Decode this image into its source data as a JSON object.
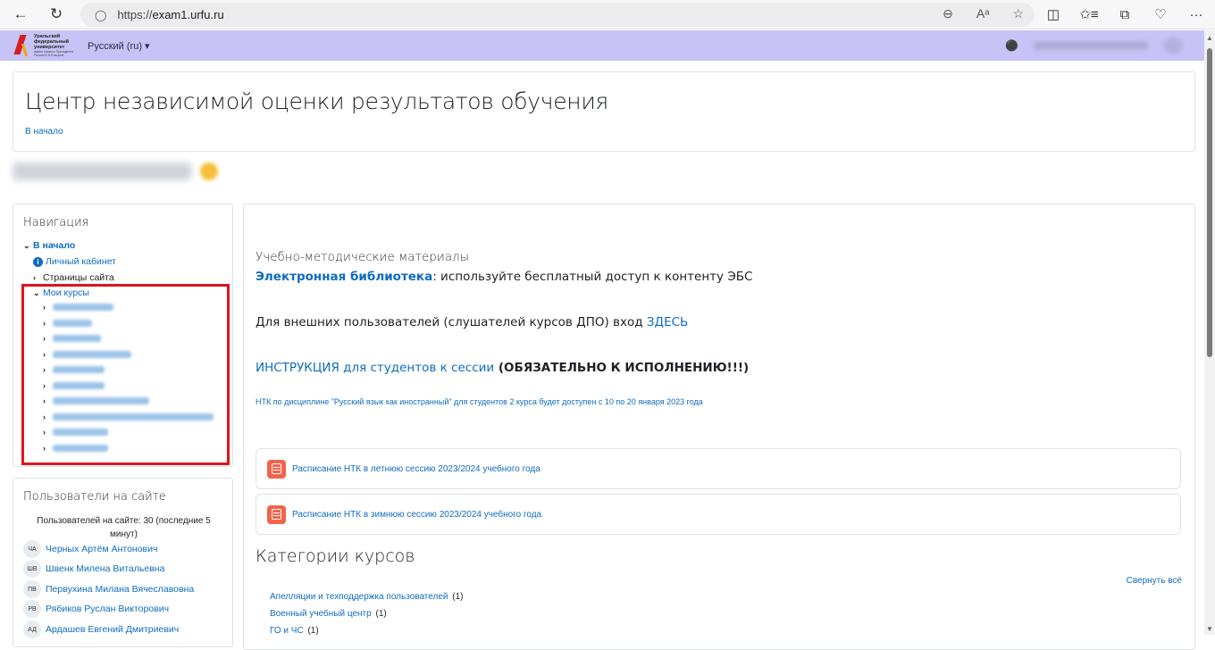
{
  "browser": {
    "url_protocol": "https://",
    "url_host": "exam1.urfu.ru",
    "icons": [
      "back-icon",
      "reload-icon",
      "lock-icon",
      "zoom-icon",
      "read-aloud-icon",
      "favorite-star-icon",
      "split-screen-icon",
      "favorites-icon",
      "collections-icon",
      "heart-pulse-icon",
      "more-icon"
    ],
    "back": "←",
    "reload": "↻",
    "lock": "🔒",
    "zoom": "⊖",
    "read_aloud": "Aᵃ",
    "star": "☆",
    "split": "◫",
    "favorites": "✩≡",
    "collections": "⧉",
    "health": "♡",
    "more": "···"
  },
  "header": {
    "logo_lines": "Уральский федеральный университет",
    "logo_small": "имени первого Президента России Б.Н.Ельцина",
    "language": "Русский (ru) ▾",
    "bell": "🔔",
    "accent_color": "#c7c3f6"
  },
  "page": {
    "title": "Центр независимой оценки результатов обучения",
    "breadcrumb": "В начало"
  },
  "navigation": {
    "title": "Навигация",
    "home": "В начало",
    "dashboard": "Личный кабинет",
    "site_pages": "Страницы сайта",
    "my_courses": "Мои курсы"
  },
  "users_online": {
    "title": "Пользователи на сайте",
    "count_text": "Пользователей на сайте: 30 (последние 5 минут)",
    "users": [
      {
        "initials": "ЧА",
        "name": "Черных Артём Антонович"
      },
      {
        "initials": "ШВ",
        "name": "Швенк Милена Витальевна"
      },
      {
        "initials": "ПВ",
        "name": "Первухина Милана Вячеславовна"
      },
      {
        "initials": "РВ",
        "name": "Рябиков Руслан Викторович"
      },
      {
        "initials": "АД",
        "name": "Ардашев Евгений Дмитриевич"
      }
    ]
  },
  "main": {
    "materials_label": "Учебно-методические материалы",
    "library_link": "Электронная библиотека",
    "library_text": ": используйте бесплатный доступ к контенту ЭБС",
    "external_text": "Для внешних пользователей (слушателей курсов ДПО) вход ",
    "external_link": "ЗДЕСЬ",
    "instruction_link": "ИНСТРУКЦИЯ для студентов к сессии",
    "instruction_bold": " (ОБЯЗАТЕЛЬНО К ИСПОЛНЕНИЮ!!!)",
    "ntk_notice": "НТК по дисциплине \"Русский язык как иностранный\" для студентов 2 курса будет доступен с 10 по 20 января 2023 года",
    "resources": [
      "Расписание НТК в летнюю сессию 2023/2024 учебного года",
      "Расписание НТК в зимнюю сессию 2023/2024 учебного года"
    ],
    "categories_title": "Категории курсов",
    "collapse_all": "Свернуть всё",
    "categories": [
      {
        "name": "Апелляции и техподдержка пользователей",
        "count": "(1)"
      },
      {
        "name": "Военный учебный центр",
        "count": "(1)"
      },
      {
        "name": "ГО и ЧС",
        "count": "(1)"
      }
    ]
  }
}
